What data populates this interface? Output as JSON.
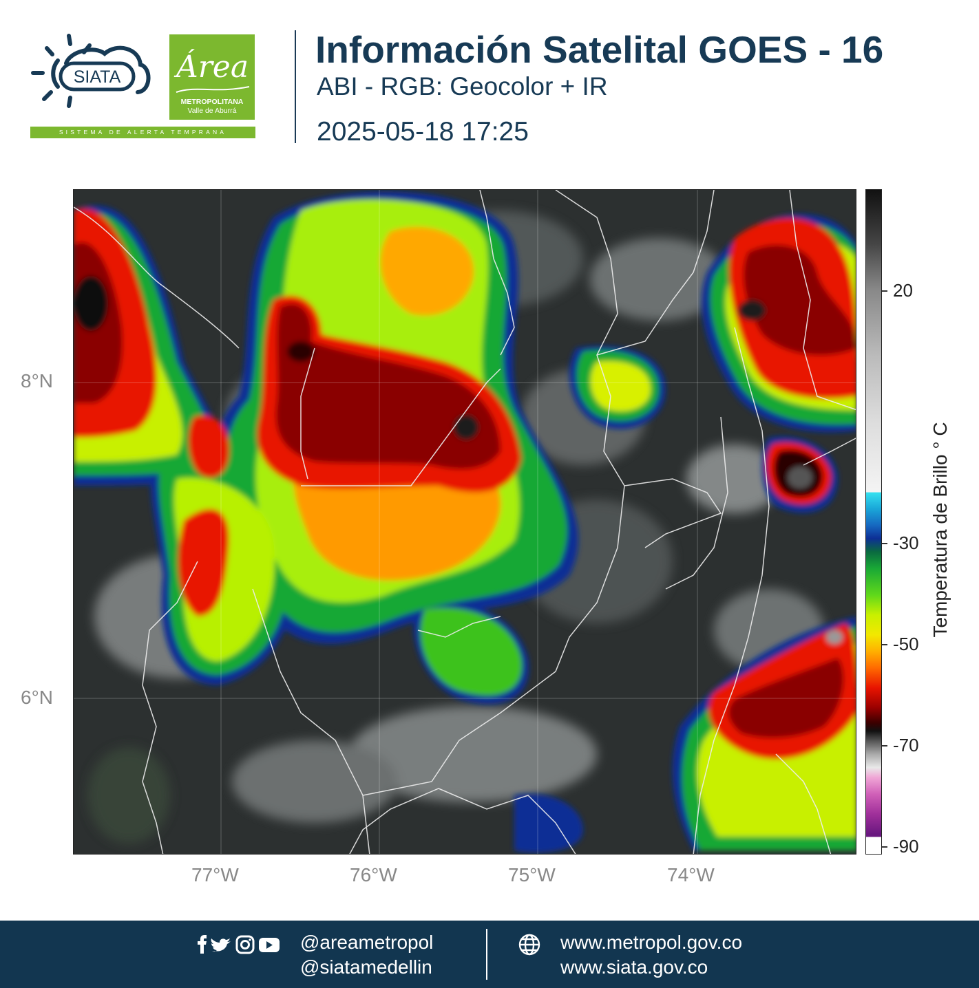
{
  "header": {
    "siata_logo_text": "SIATA",
    "area_logo_script": "Área",
    "area_logo_line1": "METROPOLITANA",
    "area_logo_line2": "Valle de Aburrá",
    "siata_tagline": "SISTEMA DE ALERTA TEMPRANA",
    "title": "Información Satelital GOES - 16",
    "subtitle": "ABI - RGB: Geocolor + IR",
    "datetime": "2025-05-18 17:25"
  },
  "map": {
    "lat_ticks": [
      "8°N",
      "6°N"
    ],
    "lon_ticks": [
      "77°W",
      "76°W",
      "75°W",
      "74°W"
    ]
  },
  "colorbar": {
    "title": "Temperatura de Brillo ° C",
    "ticks": [
      "20",
      "-30",
      "-50",
      "-70",
      "-90"
    ],
    "colors": {
      "warm_top": "#111111",
      "cold_cloud_start": "#35e0f0",
      "mid": "#19a836",
      "yellow": "#f2e800",
      "red": "#e81400",
      "dark_red": "#3a0000",
      "magenta": "#a0309a"
    }
  },
  "footer": {
    "handle_1": "@areametropol",
    "handle_2": "@siatamedellin",
    "url_1": "www.metropol.gov.co",
    "url_2": "www.siata.gov.co",
    "social_icons": [
      "facebook-icon",
      "twitter-icon",
      "instagram-icon",
      "youtube-icon"
    ],
    "web_icon": "globe-icon"
  }
}
